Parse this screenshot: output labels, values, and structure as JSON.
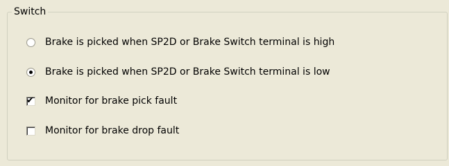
{
  "groupbox": {
    "title": "Switch"
  },
  "options": [
    {
      "type": "radio",
      "label": "Brake is picked when SP2D or Brake Switch terminal is high",
      "checked": false
    },
    {
      "type": "radio",
      "label": "Brake is picked when SP2D or Brake Switch terminal is low",
      "checked": true
    },
    {
      "type": "checkbox",
      "label": "Monitor for brake pick fault",
      "checked": true
    },
    {
      "type": "checkbox",
      "label": "Monitor for brake drop fault",
      "checked": false
    }
  ],
  "icons": {
    "check_mark": "✔"
  }
}
